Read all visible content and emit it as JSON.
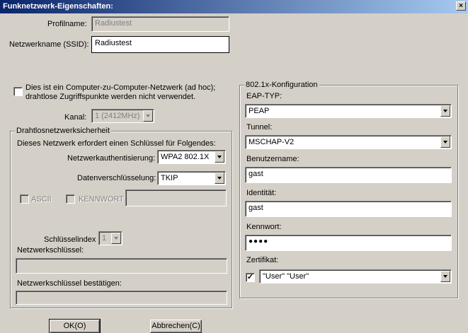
{
  "window": {
    "title": "Funknetzwerk-Eigenschaften:",
    "close_glyph": "×"
  },
  "profile": {
    "label": "Profilname:",
    "value": "Radiustest"
  },
  "ssid": {
    "label": "Netzwerkname (SSID):",
    "value": "Radiustest"
  },
  "adhoc": {
    "line1": "Dies ist ein Computer-zu-Computer-Netzwerk (ad hoc);",
    "line2": "drahtlose Zugriffspunkte werden nicht verwendet.",
    "checked": false
  },
  "channel": {
    "label": "Kanal:",
    "value": "1  (2412MHz)"
  },
  "security": {
    "legend": "Drahtlosnetzwerksicherheit",
    "intro": "Dieses Netzwerk erfordert einen Schlüssel für Folgendes:",
    "auth_label": "Netzwerkauthentisierung:",
    "auth_value": "WPA2 802.1X",
    "enc_label": "Datenverschlüsselung:",
    "enc_value": "TKIP",
    "ascii_label": "ASCII",
    "kennwort_label": "KENNWORT",
    "keyindex_label": "Schlüsselindex",
    "keyindex_value": "1",
    "key_label": "Netzwerkschlüssel:",
    "key_confirm_label": "Netzwerkschlüssel bestätigen:"
  },
  "dot1x": {
    "legend": "802.1x-Konfiguration",
    "eap_label": "EAP-TYP:",
    "eap_value": "PEAP",
    "tunnel_label": "Tunnel:",
    "tunnel_value": "MSCHAP-V2",
    "user_label": "Benutzername:",
    "user_value": "gast",
    "identity_label": "Identität:",
    "identity_value": "gast",
    "password_label": "Kennwort:",
    "password_value": "●●●●",
    "cert_label": "Zertifikat:",
    "cert_checked": true,
    "cert_check_glyph": "✓",
    "cert_value": "\"User\" \"User\""
  },
  "buttons": {
    "ok": "OK(O)",
    "cancel": "Abbrechen(C)"
  }
}
